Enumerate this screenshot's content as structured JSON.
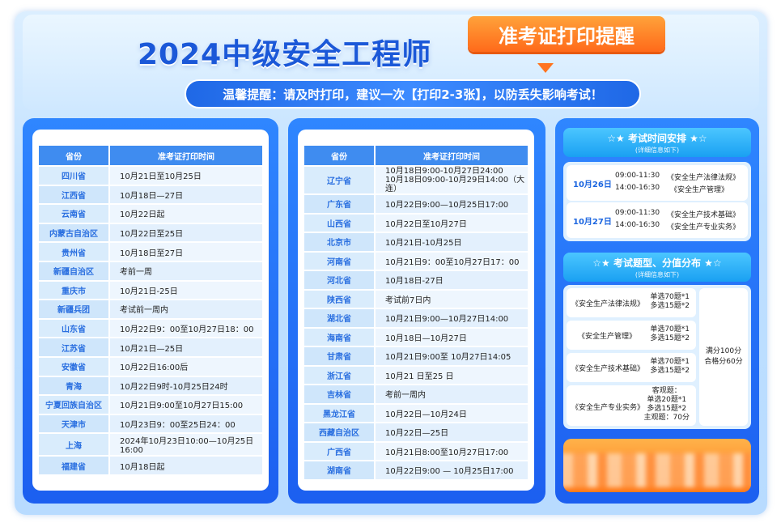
{
  "header": {
    "title": "2024中级安全工程师",
    "badge": "准考证打印提醒",
    "reminder": "温馨提醒：请及时打印，建议一次【打印2-3张】，以防丢失影响考试！"
  },
  "table_headers": {
    "province": "省份",
    "time": "准考证打印时间"
  },
  "left_rows": [
    {
      "p": "四川省",
      "t": "10月21日至10月25日"
    },
    {
      "p": "江西省",
      "t": "10月18日—27日"
    },
    {
      "p": "云南省",
      "t": "10月22日起"
    },
    {
      "p": "内蒙古自治区",
      "t": "10月22日至25日"
    },
    {
      "p": "贵州省",
      "t": "10月18日至27日"
    },
    {
      "p": "新疆自治区",
      "t": "考前一周"
    },
    {
      "p": "重庆市",
      "t": "10月21日-25日"
    },
    {
      "p": "新疆兵团",
      "t": "考试前一周内"
    },
    {
      "p": "山东省",
      "t": "10月22日9：00至10月27日18：00"
    },
    {
      "p": "江苏省",
      "t": "10月21日—25日"
    },
    {
      "p": "安徽省",
      "t": "10月22日16:00后"
    },
    {
      "p": "青海",
      "t": "10月22日9时-10月25日24时"
    },
    {
      "p": "宁夏回族自治区",
      "t": "10月21日9:00至10月27日15:00"
    },
    {
      "p": "天津市",
      "t": "10月23日9：00至25日24：00"
    },
    {
      "p": "上海",
      "t": "2024年10月23日10:00—10月25日16:00"
    },
    {
      "p": "福建省",
      "t": "10月18日起"
    }
  ],
  "right_rows": [
    {
      "p": "辽宁省",
      "t": "10月18日9:00-10月27日24:00",
      "t2": "10月18日09:00-10月29日14:00（大连）"
    },
    {
      "p": "广东省",
      "t": "10月22日9:00—10月25日17:00"
    },
    {
      "p": "山西省",
      "t": "10月22日至10月27日"
    },
    {
      "p": "北京市",
      "t": "10月21日-10月25日"
    },
    {
      "p": "河南省",
      "t": "10月21日9：00至10月27日17：00"
    },
    {
      "p": "河北省",
      "t": "10月18日-27日"
    },
    {
      "p": "陕西省",
      "t": "考试前7日内"
    },
    {
      "p": "湖北省",
      "t": "10月21日9:00—10月27日14:00"
    },
    {
      "p": "海南省",
      "t": "10月18日—10月27日"
    },
    {
      "p": "甘肃省",
      "t": "10月21日9:00至 10月27日14:05"
    },
    {
      "p": "浙江省",
      "t": "10月21 日至25 日"
    },
    {
      "p": "吉林省",
      "t": "考前一周内"
    },
    {
      "p": "黑龙江省",
      "t": "10月22日—10月24日"
    },
    {
      "p": "西藏自治区",
      "t": "10月22日—25日"
    },
    {
      "p": "广西省",
      "t": "10月21日8:00至10月27日17:00"
    },
    {
      "p": "湖南省",
      "t": "10月22日9:00 — 10月25日17:00"
    }
  ],
  "schedule": {
    "heading": "☆★  考试时间安排  ★☆",
    "sub": "(详细信息如下)",
    "days": [
      {
        "date": "10月26日",
        "slots": [
          {
            "time": "09:00-11:30",
            "subject": "《安全生产法律法规》"
          },
          {
            "time": "14:00-16:30",
            "subject": "《安全生产管理》"
          }
        ]
      },
      {
        "date": "10月27日",
        "slots": [
          {
            "time": "09:00-11:30",
            "subject": "《安全生产技术基础》"
          },
          {
            "time": "14:00-16:30",
            "subject": "《安全生产专业实务》"
          }
        ]
      }
    ]
  },
  "types": {
    "heading": "☆★  考试题型、分值分布  ★☆",
    "sub": "(详细信息如下)",
    "items": [
      {
        "name": "《安全生产法律法规》",
        "lines": [
          "单选70题*1",
          "多选15题*2"
        ]
      },
      {
        "name": "《安全生产管理》",
        "lines": [
          "单选70题*1",
          "多选15题*2"
        ]
      },
      {
        "name": "《安全生产技术基础》",
        "lines": [
          "单选70题*1",
          "多选15题*2"
        ]
      },
      {
        "name": "《安全生产专业实务》",
        "lines": [
          "客观题：",
          "单选20题*1",
          "多选15题*2",
          "主观题：70分"
        ]
      }
    ],
    "total1": "满分100分",
    "total2": "合格分60分"
  }
}
